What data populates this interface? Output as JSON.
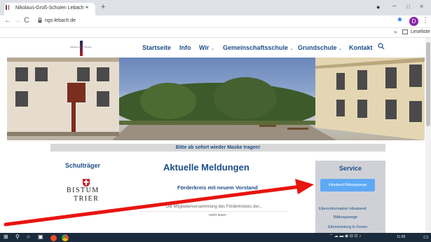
{
  "browser": {
    "tab_title": "Nikolaus-Groß-Schulen Lebach - ",
    "tab_close": "×",
    "new_tab": "+",
    "window_controls": {
      "record": "●",
      "minimize": "–",
      "maximize": "□",
      "close": "×"
    },
    "nav": {
      "back": "←",
      "forward": "→",
      "reload": "C"
    },
    "url": "ngs-lebach.de",
    "lock_icon": "lock-icon",
    "profile_initial": "D",
    "menu": "⋮",
    "bookmark_chevron": "»",
    "bookmark_label": "Leseliste"
  },
  "site_nav": {
    "logo_text": "Nikolaus Groß Schulen",
    "items": [
      {
        "label": "Startseite",
        "dropdown": false
      },
      {
        "label": "Info",
        "dropdown": false
      },
      {
        "label": "Wir",
        "dropdown": true
      },
      {
        "label": "Gemeinschaftsschule",
        "dropdown": true
      },
      {
        "label": "Grundschule",
        "dropdown": true
      },
      {
        "label": "Kontakt",
        "dropdown": false
      }
    ],
    "search_icon": "search-icon"
  },
  "banner": {
    "text": "Bitte ab sofort wieder Maske tragen!"
  },
  "left_column": {
    "heading": "Schulträger",
    "bistum_line1": "BISTUM",
    "bistum_line2": "TRIER"
  },
  "news": {
    "title": "Aktuelle Meldungen",
    "item_heading": "Förderkreis mit neuem Vorstand",
    "item_text": "Die Mitgliederversammlung des Förderkreises der...",
    "read_more": "mehr lesen"
  },
  "service": {
    "title": "Service",
    "button": "Infoabend Bildungswege",
    "link1": "Elterninformation Infoabend",
    "link2": "Bildungswege",
    "link3": "Elternleistung in Ferien"
  },
  "taskbar": {
    "time": "11:08"
  },
  "colors": {
    "brand_blue": "#1d4e89",
    "service_button": "#5da9f6",
    "annotation_arrow": "#e8140f",
    "taskbar": "#1a2b3d"
  }
}
